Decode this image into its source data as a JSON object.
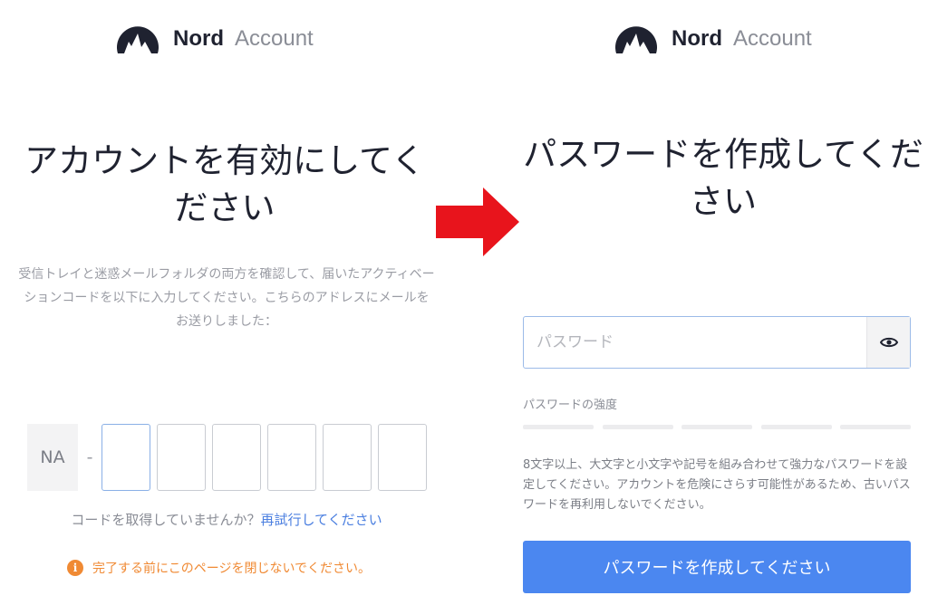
{
  "colors": {
    "brand_dark": "#1f2230",
    "accent_blue": "#4b87f0",
    "link_blue": "#4b7fe0",
    "warning_orange": "#f08a34",
    "arrow_red": "#e8141c"
  },
  "left": {
    "brand": {
      "name": "Nord",
      "product": "Account",
      "logo_icon": "nord-mountain-logo"
    },
    "title": "アカウントを有効にしてください",
    "description": "受信トレイと迷惑メールフォルダの両方を確認して、届いたアクティベーションコードを以下に入力してください。こちらのアドレスにメールをお送りしました：",
    "code": {
      "prefix": "NA",
      "dash": "-",
      "digits": [
        "",
        "",
        "",
        "",
        "",
        ""
      ]
    },
    "retry": {
      "text": "コードを取得していませんか？",
      "link": "再試行してください"
    },
    "warning": {
      "icon": "info-icon",
      "icon_glyph": "i",
      "text": "完了する前にこのページを閉じないでください。"
    }
  },
  "arrow": {
    "icon": "right-arrow-icon"
  },
  "right": {
    "brand": {
      "name": "Nord",
      "product": "Account",
      "logo_icon": "nord-mountain-logo"
    },
    "title": "パスワードを作成してください",
    "password": {
      "placeholder": "パスワード",
      "value": "",
      "toggle_icon": "eye-icon"
    },
    "strength": {
      "label": "パスワードの強度",
      "segments": 5,
      "filled": 0
    },
    "help": "8文字以上、大文字と小文字や記号を組み合わせて強力なパスワードを設定してください。アカウントを危険にさらす可能性があるため、古いパスワードを再利用しないでください。",
    "submit_label": "パスワードを作成してください"
  }
}
